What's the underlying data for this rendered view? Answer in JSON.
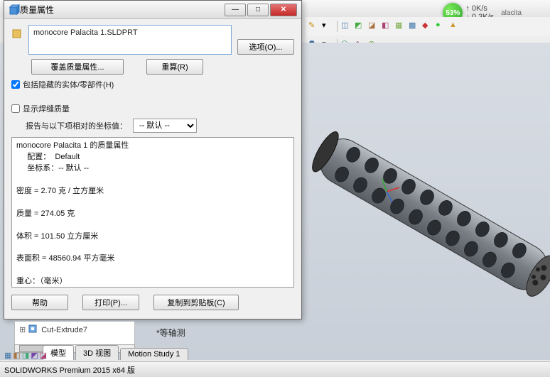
{
  "app": {
    "status_text": "SOLIDWORKS Premium 2015 x64 版",
    "perf_pct": "53%",
    "perf_line1": "0K/s",
    "perf_line2": "0.3K/s",
    "tab_label": "alacita"
  },
  "dialog": {
    "title": "质量属性",
    "filename": "monocore Palacita 1.SLDPRT",
    "btn_options": "选项(O)...",
    "btn_override": "覆盖质量属性...",
    "btn_recalc": "重算(R)",
    "chk_hidden": "包括隐藏的实体/零部件(H)",
    "chk_weld": "显示焊缝质量",
    "coord_label": "报告与以下项相对的坐标值：",
    "coord_value": "-- 默认 --",
    "report": "monocore Palacita 1 的质量属性\n     配置：  Default\n     坐标系：-- 默认 --\n\n密度 = 2.70 克 / 立方厘米\n\n质量 = 274.05 克\n\n体积 = 101.50 立方厘米\n\n表面积 = 48560.94 平方毫米\n\n重心：（毫米）\n    X = 120.59\n    Y = 0.00\n    Z = 0.00\n\n惯性主轴和惯性主力矩：（克 * 平方毫米）\n由重心决定。\n     Ix = ( 1.00,  0.00,  0.00)       Px = 49743.27\n     Iy = ( 0.00,  0.00, -1.00)       Py = 1958906.74\n     Iz = ( 0.00,  1.00,  0.00)       Pz = 1962904.18",
    "btn_help": "帮助",
    "btn_print": "打印(P)...",
    "btn_copy": "复制到剪贴板(C)"
  },
  "tree": {
    "item1": "Cut-Extrude7"
  },
  "tabs": {
    "t1": "模型",
    "t2": "3D 视图",
    "t3": "Motion Study 1"
  },
  "view": {
    "iso": "*等轴测"
  }
}
